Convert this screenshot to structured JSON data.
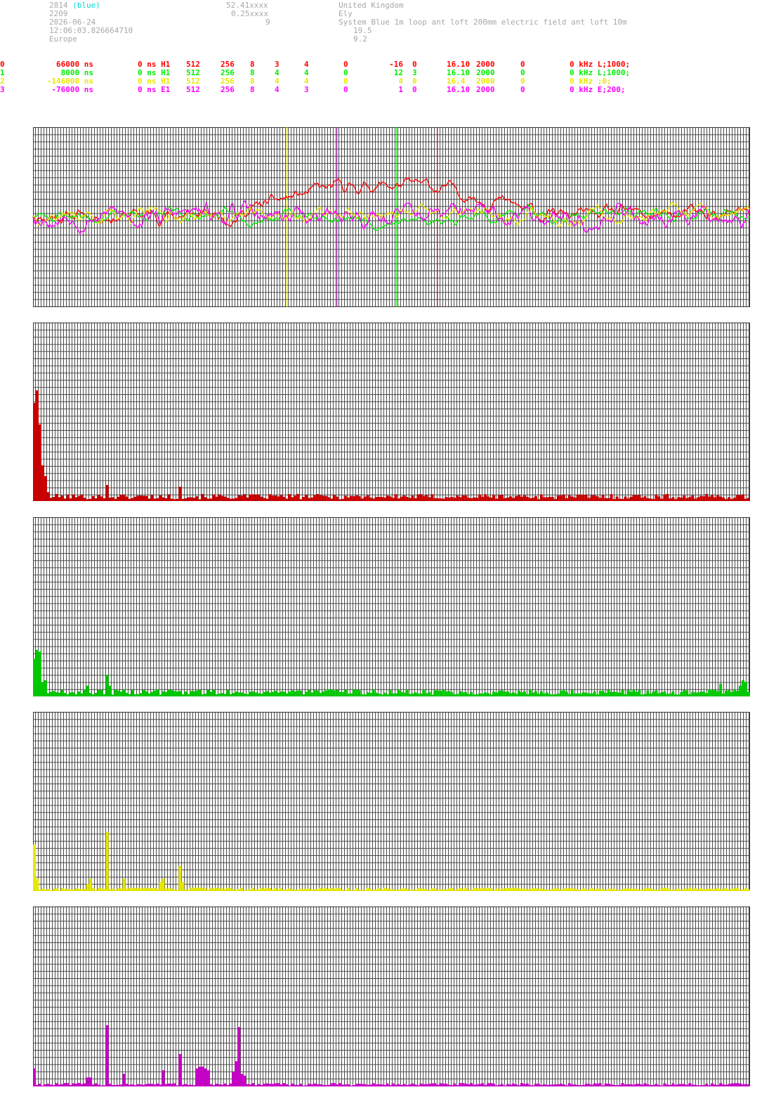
{
  "header": {
    "station_id": "2814",
    "station_tag": "(blue)",
    "number": "2209",
    "date": "2026-06-24",
    "time": "12:06:03.826664710",
    "region": "Europe",
    "latitude": "52.41xxxx",
    "longitude": "0.25xxxx",
    "elevation": "9",
    "country": "United Kingdom",
    "place": "Ely",
    "system": "System Blue 1m loop ant loft 200mm electric field ant loft 10m",
    "value_a": "19.5",
    "value_b": "9.2"
  },
  "channels": [
    {
      "index": "0",
      "offset": "66000 ns",
      "delay": "0 ns H1",
      "n1": "512",
      "n2": "256",
      "n3": "8",
      "n4": "3",
      "n5": "4",
      "n6": "0",
      "n7": "-16",
      "n8": "0",
      "freq": "16.10",
      "rate": "2000",
      "n9": "0",
      "filter": "0 kHz L;1000;",
      "color": "#ff0000"
    },
    {
      "index": "1",
      "offset": "8000 ns",
      "delay": "0 ns H1",
      "n1": "512",
      "n2": "256",
      "n3": "8",
      "n4": "4",
      "n5": "4",
      "n6": "0",
      "n7": "12",
      "n8": "3",
      "freq": "16.10",
      "rate": "2000",
      "n9": "0",
      "filter": "0 kHz L;1000;",
      "color": "#00ee00"
    },
    {
      "index": "2",
      "offset": "-146000 ns",
      "delay": "0 ns H1",
      "n1": "512",
      "n2": "256",
      "n3": "8",
      "n4": "4",
      "n5": "4",
      "n6": "0",
      "n7": "4",
      "n8": "0",
      "freq": "16.4",
      "rate": "2000",
      "n9": "0",
      "filter": "0 kHz ;0;",
      "color": "#e8e800"
    },
    {
      "index": "3",
      "offset": "-76000 ns",
      "delay": "0 ns E1",
      "n1": "512",
      "n2": "256",
      "n3": "8",
      "n4": "4",
      "n5": "3",
      "n6": "0",
      "n7": "1",
      "n8": "0",
      "freq": "16.10",
      "rate": "2000",
      "n9": "0",
      "filter": "0 kHz E;200;",
      "color": "#ff00ff"
    }
  ],
  "chart_data": [
    {
      "type": "line",
      "x_range": [
        0,
        1000
      ],
      "y_range": [
        -1,
        1
      ],
      "grid": true,
      "markers": [
        {
          "x": 354,
          "color": "#e8e800"
        },
        {
          "x": 424,
          "color": "#ff00ff"
        },
        {
          "x": 507,
          "color": "#00ee00"
        },
        {
          "x": 564,
          "color": "#c80000"
        }
      ],
      "series": [
        {
          "color": "#ff0000",
          "amp": 0.12,
          "seed": 11,
          "envelope": {
            "center": 495,
            "width": 210,
            "height": 0.33
          }
        },
        {
          "color": "#00ee00",
          "amp": 0.1,
          "seed": 23,
          "envelope": {
            "center": 495,
            "width": 110,
            "height": -0.08
          }
        },
        {
          "color": "#e8e800",
          "amp": 0.12,
          "seed": 37,
          "envelope": {
            "center": 0,
            "width": 1,
            "height": 0
          }
        },
        {
          "color": "#ff00ff",
          "amp": 0.17,
          "seed": 53,
          "envelope": {
            "center": 0,
            "width": 1,
            "height": 0
          }
        }
      ]
    },
    {
      "type": "bar",
      "color": "#c80000",
      "bins": 256,
      "ylim": [
        0,
        1
      ],
      "peaks": [
        [
          0,
          0.55
        ],
        [
          1,
          0.62
        ],
        [
          2,
          0.43
        ],
        [
          3,
          0.2
        ],
        [
          4,
          0.14
        ],
        [
          5,
          0.05
        ],
        [
          26,
          0.09
        ],
        [
          52,
          0.08
        ]
      ],
      "baseline": 0.025
    },
    {
      "type": "bar",
      "color": "#00c800",
      "bins": 256,
      "ylim": [
        0,
        1
      ],
      "peaks": [
        [
          0,
          0.21
        ],
        [
          1,
          0.26
        ],
        [
          2,
          0.25
        ],
        [
          3,
          0.08
        ],
        [
          4,
          0.09
        ],
        [
          19,
          0.06
        ],
        [
          26,
          0.12
        ],
        [
          27,
          0.06
        ],
        [
          245,
          0.07
        ],
        [
          252,
          0.06
        ],
        [
          253,
          0.09
        ],
        [
          254,
          0.08
        ]
      ],
      "baseline": 0.025
    },
    {
      "type": "bar",
      "color": "#e8e800",
      "bins": 256,
      "ylim": [
        0,
        1
      ],
      "peaks": [
        [
          0,
          0.26
        ],
        [
          1,
          0.07
        ],
        [
          19,
          0.04
        ],
        [
          20,
          0.07
        ],
        [
          26,
          0.33
        ],
        [
          32,
          0.07
        ],
        [
          45,
          0.05
        ],
        [
          46,
          0.07
        ],
        [
          52,
          0.14
        ],
        [
          53,
          0.05
        ]
      ],
      "baseline": 0.012
    },
    {
      "type": "bar",
      "color": "#c800c8",
      "bins": 256,
      "ylim": [
        0,
        1
      ],
      "peaks": [
        [
          0,
          0.1
        ],
        [
          19,
          0.05
        ],
        [
          20,
          0.05
        ],
        [
          26,
          0.34
        ],
        [
          32,
          0.07
        ],
        [
          46,
          0.09
        ],
        [
          52,
          0.18
        ],
        [
          58,
          0.1
        ],
        [
          59,
          0.11
        ],
        [
          60,
          0.11
        ],
        [
          61,
          0.1
        ],
        [
          62,
          0.09
        ],
        [
          71,
          0.08
        ],
        [
          72,
          0.14
        ],
        [
          73,
          0.33
        ],
        [
          74,
          0.07
        ],
        [
          75,
          0.06
        ]
      ],
      "baseline": 0.012
    }
  ]
}
